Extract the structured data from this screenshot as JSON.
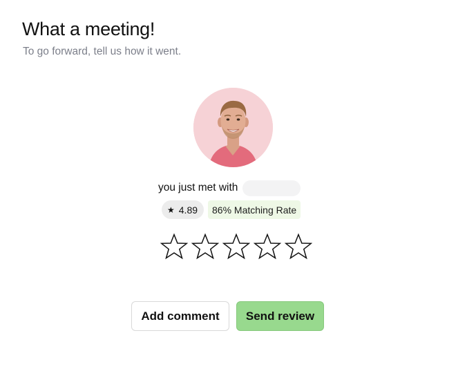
{
  "header": {
    "title": "What a meeting!",
    "subtitle": "To go forward, tell us how it went."
  },
  "profile": {
    "avatar_icon": "person-photo",
    "avatar_bg": "#f6d2d6",
    "met_text": "you just met with",
    "rating_icon": "star-icon",
    "rating": "4.89",
    "matching_rate": "86% Matching Rate"
  },
  "review": {
    "star_count": 5,
    "selected_stars": 0,
    "star_icon": "star-outline-icon"
  },
  "actions": {
    "add_comment_label": "Add comment",
    "send_review_label": "Send review",
    "send_review_color": "#98d98e"
  }
}
